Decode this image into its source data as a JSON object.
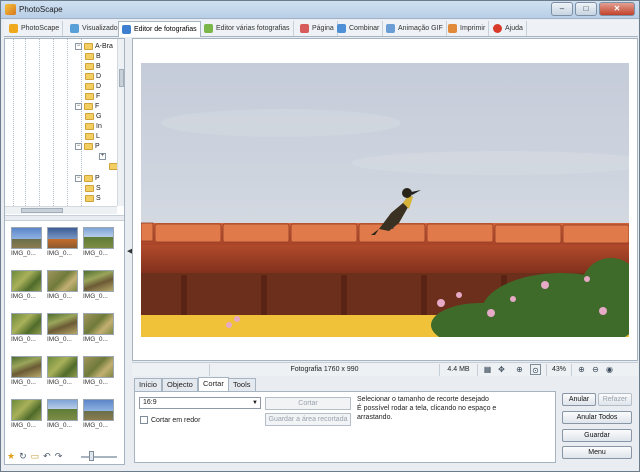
{
  "window": {
    "title": "PhotoScape",
    "minimize": "–",
    "maximize": "□",
    "close": "✕"
  },
  "tabs": [
    {
      "label": "PhotoScape",
      "icon": "photoscape-icon",
      "color": "#f0a81c"
    },
    {
      "label": "Visualizador",
      "icon": "viewer-icon",
      "color": "#5aa0d8"
    },
    {
      "label": "Editor de fotografias",
      "icon": "editor-icon",
      "color": "#3f7fd0",
      "active": true
    },
    {
      "label": "Editor várias fotografias",
      "icon": "batch-editor-icon",
      "color": "#7ab648"
    },
    {
      "label": "Página",
      "icon": "page-icon",
      "color": "#d85b5b"
    },
    {
      "label": "Combinar",
      "icon": "combine-icon",
      "color": "#4f8fd6"
    },
    {
      "label": "Animação GIF",
      "icon": "gif-icon",
      "color": "#6a9ed4"
    },
    {
      "label": "Imprimir",
      "icon": "print-icon",
      "color": "#e08a3a"
    },
    {
      "label": "Ajuda",
      "icon": "help-icon",
      "color": "#d83a2a"
    }
  ],
  "tree": {
    "root": "A-Bra",
    "items": [
      "B",
      "B",
      "D",
      "D",
      "F",
      "F",
      "G",
      "In",
      "L",
      "P",
      "",
      "",
      "P",
      "S",
      "S"
    ]
  },
  "thumbnails": [
    {
      "label": "IMG_0...",
      "style": "sky"
    },
    {
      "label": "IMG_0...",
      "style": "dusk"
    },
    {
      "label": "IMG_0...",
      "style": "bluegr"
    },
    {
      "label": "IMG_0...",
      "style": "green"
    },
    {
      "label": "IMG_0...",
      "style": "dry"
    },
    {
      "label": "IMG_0...",
      "style": "mixed"
    },
    {
      "label": "IMG_0...",
      "style": "green"
    },
    {
      "label": "IMG_0...",
      "style": "mixed"
    },
    {
      "label": "IMG_0...",
      "style": "dry"
    },
    {
      "label": "IMG_0...",
      "style": "mixed"
    },
    {
      "label": "IMG_0...",
      "style": "green"
    },
    {
      "label": "IMG_0...",
      "style": "dry"
    },
    {
      "label": "IMG_0...",
      "style": "green"
    },
    {
      "label": "IMG_0...",
      "style": "bluegr"
    },
    {
      "label": "IMG_0...",
      "style": "sky"
    }
  ],
  "left_toolbar": {
    "icons": [
      "star-icon",
      "rotate-icon",
      "folder-icon",
      "undo-arrow-icon",
      "redo-arrow-icon"
    ]
  },
  "status": {
    "photo_info": "Fotografia 1760 x 990",
    "file_size": "4.4 MB",
    "zoom": "43%"
  },
  "editor_tabs": [
    "Início",
    "Objecto",
    "Cortar",
    "Tools"
  ],
  "crop": {
    "ratio": "16:9",
    "crop_around_label": "Cortar em redor",
    "crop_button": "Cortar",
    "save_crop_button": "Guardar a área recortada",
    "hint_lines": [
      "Selecionar o tamanho de recorte desejado",
      "É possível rodar a tela, clicando no espaço e",
      "arrastando."
    ]
  },
  "actions": {
    "undo": "Anular",
    "redo": "Refazer",
    "undo_all": "Anular Todos",
    "save": "Guardar",
    "menu": "Menu"
  }
}
